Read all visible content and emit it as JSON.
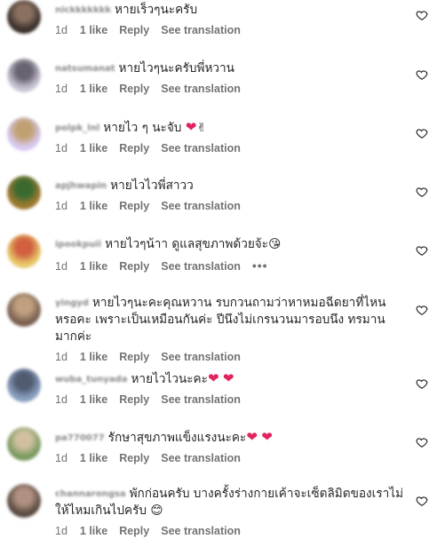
{
  "comments": [
    {
      "text": "หายเร็วๆนะครับ",
      "time": "1d",
      "likes": "1 like",
      "reply": "Reply",
      "translate": "See translation",
      "avatar_colors": [
        "#3a302c",
        "#8a7060"
      ],
      "hearts": 0,
      "extra_emoji": ""
    },
    {
      "text": "หายไวๆนะครับพี่หวาน",
      "time": "1d",
      "likes": "1 like",
      "reply": "Reply",
      "translate": "See translation",
      "avatar_colors": [
        "#c9c4d4",
        "#6a6470"
      ],
      "hearts": 0,
      "extra_emoji": ""
    },
    {
      "text": "หายไว ๆ นะจับ",
      "time": "1d",
      "likes": "1 like",
      "reply": "Reply",
      "translate": "See translation",
      "avatar_colors": [
        "#d7c9f0",
        "#c0a070"
      ],
      "hearts": 1,
      "extra_emoji": "✌"
    },
    {
      "text": "หายไวไวพี่สาวว",
      "time": "1d",
      "likes": "1 like",
      "reply": "Reply",
      "translate": "See translation",
      "avatar_colors": [
        "#a07a30",
        "#3a6a30"
      ],
      "hearts": 0,
      "extra_emoji": ""
    },
    {
      "text": "หายไวๆน้าา ดูแลสุขภาพด้วยจ้ะ",
      "time": "1d",
      "likes": "1 like",
      "reply": "Reply",
      "translate": "See translation",
      "avatar_colors": [
        "#e8c86a",
        "#d06040"
      ],
      "hearts": 0,
      "extra_emoji": "😘",
      "more": "•••"
    },
    {
      "text": "หายไวๆนะคะคุณหวาน รบกวนถามว่าหาหมอฉีดยาที่ไหนหรอคะ เพราะเป็นเหมือนกันค่ะ ปีนึงไม่เกรนวนมารอบนึง ทรมานมากค่ะ",
      "time": "1d",
      "likes": "1 like",
      "reply": "Reply",
      "translate": "See translation",
      "avatar_colors": [
        "#7a6050",
        "#c0a080"
      ],
      "hearts": 0,
      "extra_emoji": ""
    },
    {
      "text": "หายไวไวนะคะ",
      "time": "1d",
      "likes": "1 like",
      "reply": "Reply",
      "translate": "See translation",
      "avatar_colors": [
        "#8aa0c0",
        "#505a70"
      ],
      "hearts": 2,
      "extra_emoji": ""
    },
    {
      "text": "รักษาสุขภาพแข็งแรงนะคะ",
      "time": "1d",
      "likes": "1 like",
      "reply": "Reply",
      "translate": "See translation",
      "avatar_colors": [
        "#7a9a60",
        "#d0c0a0"
      ],
      "hearts": 2,
      "extra_emoji": ""
    },
    {
      "text": "พักก่อนครับ บางครั้งร่างกายเค้าจะเซ็ตลิมิตของเราไม่ให้ไหมเกินไปครับ",
      "time": "1d",
      "likes": "1 like",
      "reply": "Reply",
      "translate": "See translation",
      "avatar_colors": [
        "#5a4a40",
        "#b09080"
      ],
      "hearts": 0,
      "extra_emoji": "😊"
    }
  ]
}
